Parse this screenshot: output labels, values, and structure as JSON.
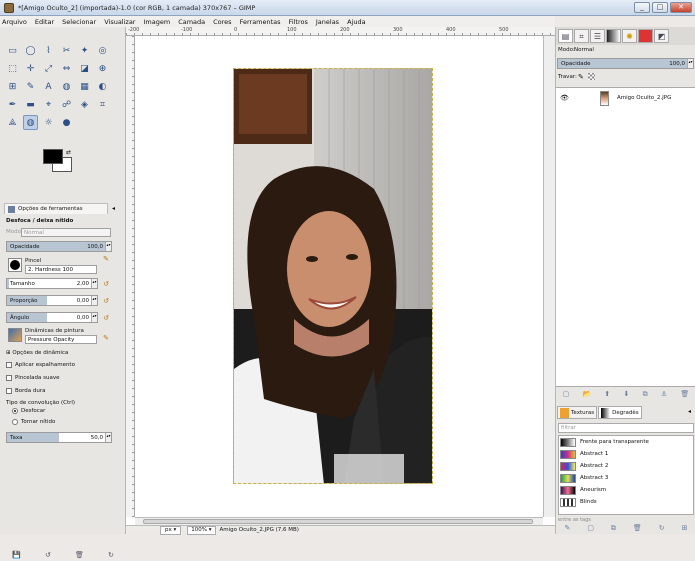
{
  "window": {
    "title": "*[Amigo Oculto_2] (importada)-1.0 (cor RGB, 1 camada) 370x767 – GIMP",
    "min": "_",
    "max": "□",
    "close": "✕"
  },
  "menu": [
    "Arquivo",
    "Editar",
    "Selecionar",
    "Visualizar",
    "Imagem",
    "Camada",
    "Cores",
    "Ferramentas",
    "Filtros",
    "Janelas",
    "Ajuda"
  ],
  "toolbox": {
    "tools": [
      "▭",
      "◯",
      "⌇",
      "✂",
      "✦",
      "◎",
      "⬚",
      "✛",
      "⤢",
      "⇔",
      "◪",
      "⊕",
      "⊞",
      "✎",
      "A",
      "◍",
      "▦",
      "◐",
      "✒",
      "▬",
      "⌖",
      "☍",
      "◈",
      "⌗",
      "⟁",
      "◍",
      "☼",
      "●"
    ],
    "selected_index": 25,
    "swap": "⇄",
    "options_tab": "Opções de ferramentas",
    "close": "◂",
    "tool_name": "Desfoca / deixa nítido",
    "mode_label": "Modo:",
    "mode_value": "Normal",
    "opacity_label": "Opacidade",
    "opacity_value": "100,0",
    "opacity_fraction": 1.0,
    "brush_label": "Pincel",
    "brush_value": "2. Hardness 100",
    "size_label": "Tamanho",
    "size_value": "2,00",
    "ratio_label": "Proporção",
    "ratio_value": "0,00",
    "angle_label": "Ângulo",
    "angle_value": "0,00",
    "dyn_label": "Dinâmicas de pintura",
    "dyn_value": "Pressure Opacity",
    "dyn_options": "Opções de dinâmica",
    "jitter": "Aplicar espalhamento",
    "smooth": "Pincelada suave",
    "hard": "Borda dura",
    "conv_label": "Tipo de convolução (Ctrl)",
    "blur": "Desfocar",
    "sharpen": "Tornar nítido",
    "rate_label": "Taxa",
    "rate_value": "50,0",
    "rate_fraction": 0.5,
    "bottom_icons": [
      "💾",
      "↺",
      "🗑",
      "↻"
    ]
  },
  "canvas": {
    "ruler_ticks": [
      "-200",
      "-100",
      "0",
      "100",
      "200",
      "300",
      "400",
      "500"
    ],
    "unit": "px ▾",
    "zoom": "100% ▾",
    "status": "Amigo Oculto_2.JPG (7,6 MB)"
  },
  "layers": {
    "dock_tabs": [
      "▤",
      "⌗",
      "☰",
      "◧",
      "✺",
      "■",
      "◩"
    ],
    "mode_label": "Modo:",
    "mode_value": "Normal",
    "opacity_label": "Opacidade",
    "opacity_value": "100,0",
    "lock_label": "Travar:",
    "eye": "👁",
    "layer_name": "Amigo Oculto_2.JPG",
    "buttons": [
      "▢",
      "📂",
      "⬆",
      "⬇",
      "⧉",
      "⚓",
      "🗑"
    ]
  },
  "gradients": {
    "tab_textures": "Texturas",
    "tab_gradients": "Degradês",
    "close": "◂",
    "filter_placeholder": "filtrar",
    "items": [
      {
        "name": "Frente para transparente",
        "swatch": "linear-gradient(90deg,#000,rgba(0,0,0,0))"
      },
      {
        "name": "Abstract 1",
        "swatch": "linear-gradient(90deg,#3040d0,#d03080,#e0c040)"
      },
      {
        "name": "Abstract 2",
        "swatch": "linear-gradient(90deg,#e02050,#3050e0,#f0f060)"
      },
      {
        "name": "Abstract 3",
        "swatch": "linear-gradient(90deg,#20a040,#e0e060,#2040a0)"
      },
      {
        "name": "Aneurism",
        "swatch": "linear-gradient(90deg,#401060,#f07090,#000)"
      },
      {
        "name": "Blinds",
        "swatch": "repeating-linear-gradient(90deg,#fff 0 2px,#333 2px 4px)"
      }
    ],
    "tags_placeholder": "entre as tags",
    "foot_icons": [
      "✎",
      "▢",
      "⧉",
      "🗑",
      "↻",
      "⊞"
    ]
  }
}
